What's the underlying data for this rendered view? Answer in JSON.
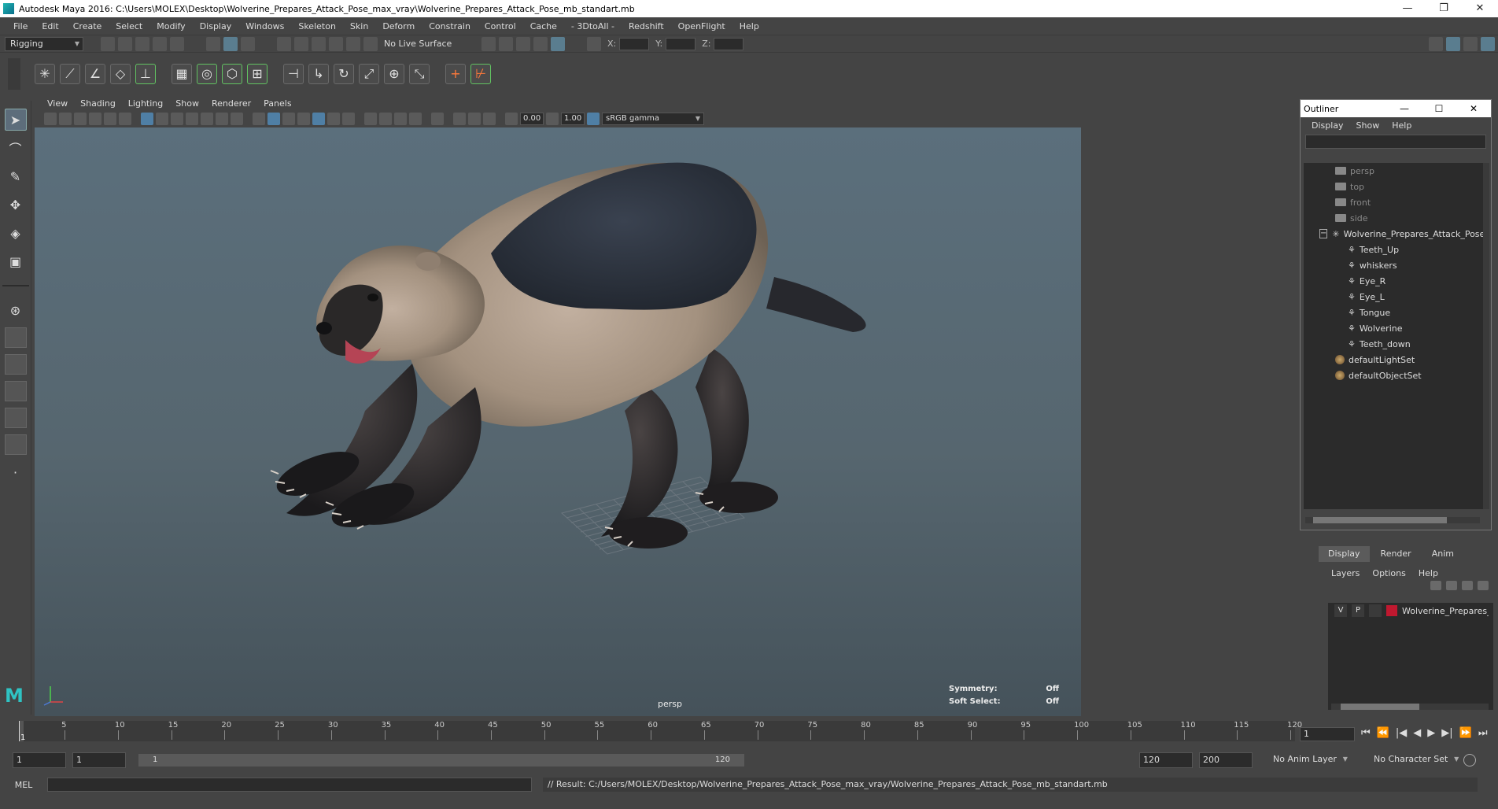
{
  "window": {
    "title": "Autodesk Maya 2016: C:\\Users\\MOLEX\\Desktop\\Wolverine_Prepares_Attack_Pose_max_vray\\Wolverine_Prepares_Attack_Pose_mb_standart.mb",
    "minimize": "—",
    "restore": "❐",
    "close": "✕"
  },
  "menubar": [
    "File",
    "Edit",
    "Create",
    "Select",
    "Modify",
    "Display",
    "Windows",
    "Skeleton",
    "Skin",
    "Deform",
    "Constrain",
    "Control",
    "Cache",
    "- 3DtoAll -",
    "Redshift",
    "OpenFlight",
    "Help"
  ],
  "statusline": {
    "menuset": "Rigging",
    "live_surface": "No Live Surface",
    "x_label": "X:",
    "y_label": "Y:",
    "z_label": "Z:"
  },
  "panel": {
    "menus": [
      "View",
      "Shading",
      "Lighting",
      "Show",
      "Renderer",
      "Panels"
    ],
    "exposure": "0.00",
    "gamma": "1.00",
    "color_space": "sRGB gamma"
  },
  "viewport": {
    "camera_label": "persp",
    "symmetry_label": "Symmetry:",
    "symmetry_value": "Off",
    "soft_select_label": "Soft Select:",
    "soft_select_value": "Off"
  },
  "outliner": {
    "title": "Outliner",
    "menus": [
      "Display",
      "Show",
      "Help"
    ],
    "items": [
      {
        "label": "persp",
        "icon": "camera-icon",
        "dim": true
      },
      {
        "label": "top",
        "icon": "camera-icon",
        "dim": true
      },
      {
        "label": "front",
        "icon": "camera-icon",
        "dim": true
      },
      {
        "label": "side",
        "icon": "camera-icon",
        "dim": true
      },
      {
        "label": "Wolverine_Prepares_Attack_Pose",
        "icon": "group-icon",
        "expander": "−"
      },
      {
        "label": "Teeth_Up",
        "icon": "mesh-icon"
      },
      {
        "label": "whiskers",
        "icon": "mesh-icon"
      },
      {
        "label": "Eye_R",
        "icon": "mesh-icon"
      },
      {
        "label": "Eye_L",
        "icon": "mesh-icon"
      },
      {
        "label": "Tongue",
        "icon": "mesh-icon"
      },
      {
        "label": "Wolverine",
        "icon": "mesh-icon"
      },
      {
        "label": "Teeth_down",
        "icon": "mesh-icon"
      },
      {
        "label": "defaultLightSet",
        "icon": "set-icon"
      },
      {
        "label": "defaultObjectSet",
        "icon": "set-icon"
      }
    ]
  },
  "layer_editor": {
    "tabs": [
      "Display",
      "Render",
      "Anim"
    ],
    "menus": [
      "Layers",
      "Options",
      "Help"
    ],
    "layer": {
      "v": "V",
      "p": "P",
      "name": "Wolverine_Prepares_A",
      "color": "#c0182f"
    }
  },
  "timeline": {
    "ticks": [
      "5",
      "10",
      "15",
      "20",
      "25",
      "30",
      "35",
      "40",
      "45",
      "50",
      "55",
      "60",
      "65",
      "70",
      "75",
      "80",
      "85",
      "90",
      "95",
      "100",
      "105",
      "110",
      "115",
      "120"
    ],
    "cursor": "1",
    "current_frame": "1",
    "controls": [
      "⏮",
      "⏪",
      "|◀",
      "◀",
      "▶",
      "▶|",
      "⏩",
      "⏭"
    ]
  },
  "range": {
    "start": "1",
    "playback_start": "1",
    "bar_start": "1",
    "bar_end": "120",
    "playback_end": "120",
    "end": "200",
    "anim_layer": "No Anim Layer",
    "character_set": "No Character Set"
  },
  "command": {
    "label": "MEL",
    "result": "// Result: C:/Users/MOLEX/Desktop/Wolverine_Prepares_Attack_Pose_max_vray/Wolverine_Prepares_Attack_Pose_mb_standart.mb"
  },
  "colors": {
    "accent": "#2fc3c3",
    "highlight": "#61c261"
  }
}
